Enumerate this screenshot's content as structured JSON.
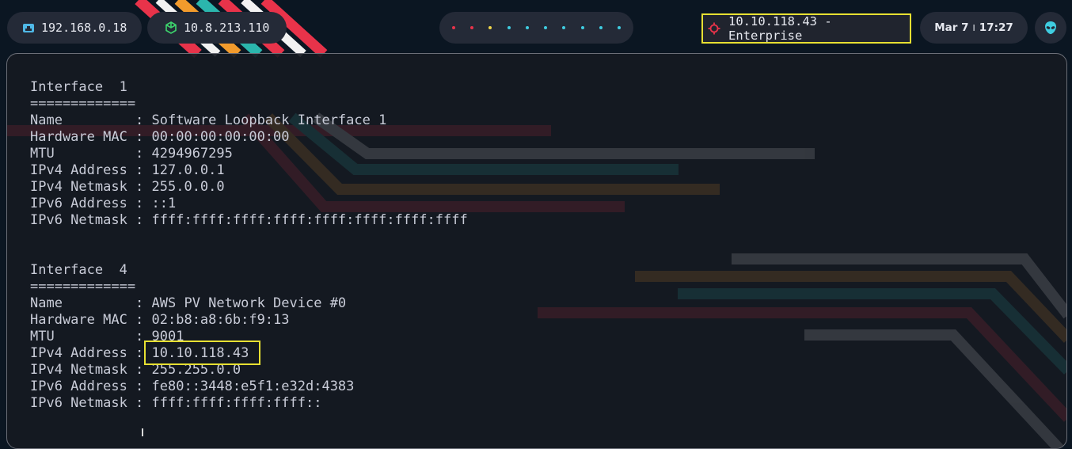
{
  "topbar": {
    "local_ip": "192.168.0.18",
    "vpn_ip": "10.8.213.110",
    "target": "10.10.118.43 - Enterprise",
    "date": "Mar 7",
    "sep": "I",
    "time": "17:27",
    "workspaces": [
      {
        "color": "#e8334a"
      },
      {
        "color": "#e8334a"
      },
      {
        "color": "#f0d64a"
      },
      {
        "color": "#3fcde0"
      },
      {
        "color": "#3fcde0"
      },
      {
        "color": "#3fcde0"
      },
      {
        "color": "#3fcde0"
      },
      {
        "color": "#3fcde0"
      },
      {
        "color": "#3fcde0"
      },
      {
        "color": "#3fcde0"
      }
    ]
  },
  "terminal": {
    "lines": [
      "Interface  1",
      "=============",
      "Name         : Software Loopback Interface 1",
      "Hardware MAC : 00:00:00:00:00:00",
      "MTU          : 4294967295",
      "IPv4 Address : 127.0.0.1",
      "IPv4 Netmask : 255.0.0.0",
      "IPv6 Address : ::1",
      "IPv6 Netmask : ffff:ffff:ffff:ffff:ffff:ffff:ffff:ffff",
      "",
      "",
      "Interface  4",
      "=============",
      "Name         : AWS PV Network Device #0",
      "Hardware MAC : 02:b8:a8:6b:f9:13",
      "MTU          : 9001",
      "IPv4 Address : 10.10.118.43",
      "IPv4 Netmask : 255.255.0.0",
      "IPv6 Address : fe80::3448:e5f1:e32d:4383",
      "IPv6 Netmask : ffff:ffff:ffff:ffff::"
    ]
  },
  "colors": {
    "highlight": "#e7e032",
    "vpn_icon": "#3dd56d",
    "target_icon": "#e8334a",
    "local_icon": "#4fb8e6",
    "alien_icon": "#3fcde0"
  }
}
